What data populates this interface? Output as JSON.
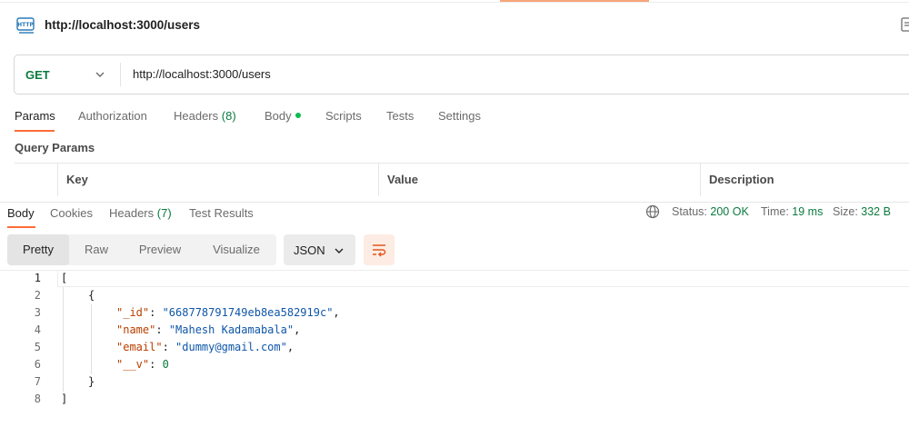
{
  "request": {
    "title": "http://localhost:3000/users",
    "method": "GET",
    "url": "http://localhost:3000/users"
  },
  "request_tabs": [
    {
      "label": "Params",
      "count": ""
    },
    {
      "label": "Authorization",
      "count": ""
    },
    {
      "label": "Headers",
      "count": "(8)"
    },
    {
      "label": "Body",
      "count": ""
    },
    {
      "label": "Scripts",
      "count": ""
    },
    {
      "label": "Tests",
      "count": ""
    },
    {
      "label": "Settings",
      "count": ""
    }
  ],
  "query_params": {
    "title": "Query Params",
    "columns": [
      "Key",
      "Value",
      "Description"
    ]
  },
  "response_tabs": [
    {
      "label": "Body",
      "count": ""
    },
    {
      "label": "Cookies",
      "count": ""
    },
    {
      "label": "Headers",
      "count": "(7)"
    },
    {
      "label": "Test Results",
      "count": ""
    }
  ],
  "status": {
    "status_label": "Status:",
    "status_value": "200 OK",
    "time_label": "Time:",
    "time_value": "19 ms",
    "size_label": "Size:",
    "size_value": "332 B"
  },
  "view_modes": [
    "Pretty",
    "Raw",
    "Preview",
    "Visualize"
  ],
  "format": "JSON",
  "code": {
    "line_numbers": [
      "1",
      "2",
      "3",
      "4",
      "5",
      "6",
      "7",
      "8"
    ],
    "open_bracket": "[",
    "open_brace": "{",
    "fields": [
      {
        "key": "\"_id\"",
        "value": "\"668778791749eb8ea582919c\"",
        "type": "string",
        "comma": ","
      },
      {
        "key": "\"name\"",
        "value": "\"Mahesh Kadamabala\"",
        "type": "string",
        "comma": ","
      },
      {
        "key": "\"email\"",
        "value": "\"dummy@gmail.com\"",
        "type": "string",
        "comma": ","
      },
      {
        "key": "\"__v\"",
        "value": "0",
        "type": "number",
        "comma": ""
      }
    ],
    "close_brace": "}",
    "close_bracket": "]"
  },
  "icons": {
    "http": "http-icon",
    "method_dropdown": "chevron-down-icon",
    "status_globe": "globe-icon",
    "format_dropdown": "chevron-down-icon",
    "wrap": "wrap-lines-icon",
    "top_right": "document-icon"
  },
  "colors": {
    "accent": "#ff6c37",
    "success": "#0b7a3e",
    "json_key": "#b83f00",
    "json_string": "#0f56a8",
    "json_number": "#0b7a3e"
  }
}
